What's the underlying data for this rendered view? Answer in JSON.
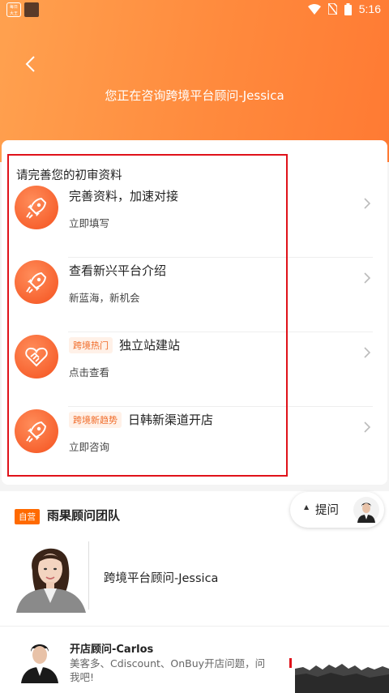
{
  "status_bar": {
    "time": "5:16",
    "app_icon_text": "每日\n大王"
  },
  "header": {
    "title": "您正在咨询跨境平台顾问-Jessica"
  },
  "card": {
    "title": "请完善您的初审资料",
    "rows": [
      {
        "tag": "",
        "main": "完善资料，加速对接",
        "sub": "立即填写",
        "icon": "rocket-icon"
      },
      {
        "tag": "",
        "main": "查看新兴平台介绍",
        "sub": "新蓝海，新机会",
        "icon": "rocket-icon"
      },
      {
        "tag": "跨境热门",
        "main": "独立站建站",
        "sub": "点击查看",
        "icon": "handshake-heart-icon"
      },
      {
        "tag": "跨境新趋势",
        "main": "日韩新渠道开店",
        "sub": "立即咨询",
        "icon": "rocket-icon"
      }
    ]
  },
  "team": {
    "badge": "自营",
    "name": "雨果顾问团队"
  },
  "ask_button": {
    "label": "提问"
  },
  "consultant": {
    "name": "跨境平台顾问-Jessica"
  },
  "message": {
    "name": "开店顾问-Carlos",
    "text": "美客多、Cdiscount、OnBuy开店问题，问我吧!"
  },
  "colors": {
    "accent": "#ff7a33",
    "tag_text": "#f06b28",
    "badge_bg": "#ff6a00",
    "highlight_border": "#e0121a"
  }
}
